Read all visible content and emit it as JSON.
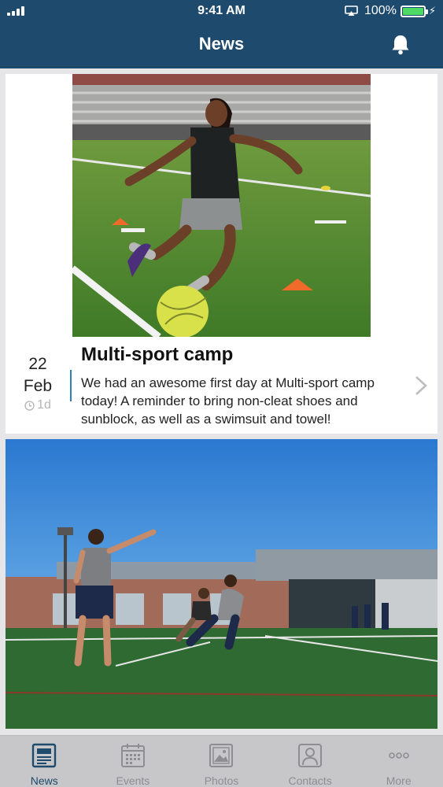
{
  "status_bar": {
    "time": "9:41 AM",
    "battery_percent": "100%",
    "battery_level": 1.0,
    "icons": [
      "signal-icon",
      "airplay-icon",
      "battery-icon",
      "charging-bolt-icon"
    ]
  },
  "header": {
    "title": "News",
    "notifications_icon": "bell-icon",
    "background": "#1e4a6e"
  },
  "feed": [
    {
      "image": "photo: young girl dribbling a yellow soccer ball on a turf field past orange cones, stadium bleachers behind",
      "day": "22",
      "month": "Feb",
      "ago": "1d",
      "title": "Multi-sport camp",
      "body": "We had an awesome first day at Multi-sport camp today! A reminder to bring non-cleat shoes and sunblock, as well as a swimsuit and towel!"
    },
    {
      "image": "photo: coach pointing as athletes sprint on a turf field in front of a school building under a blue sky"
    }
  ],
  "tab_bar": {
    "active": "News",
    "accent": "#1e4a6e",
    "inactive_color": "#8e8e92",
    "tabs": [
      {
        "label": "News",
        "icon": "newspaper-icon"
      },
      {
        "label": "Events",
        "icon": "calendar-icon"
      },
      {
        "label": "Photos",
        "icon": "photo-icon"
      },
      {
        "label": "Contacts",
        "icon": "contact-icon"
      },
      {
        "label": "More",
        "icon": "more-dots-icon"
      }
    ]
  }
}
